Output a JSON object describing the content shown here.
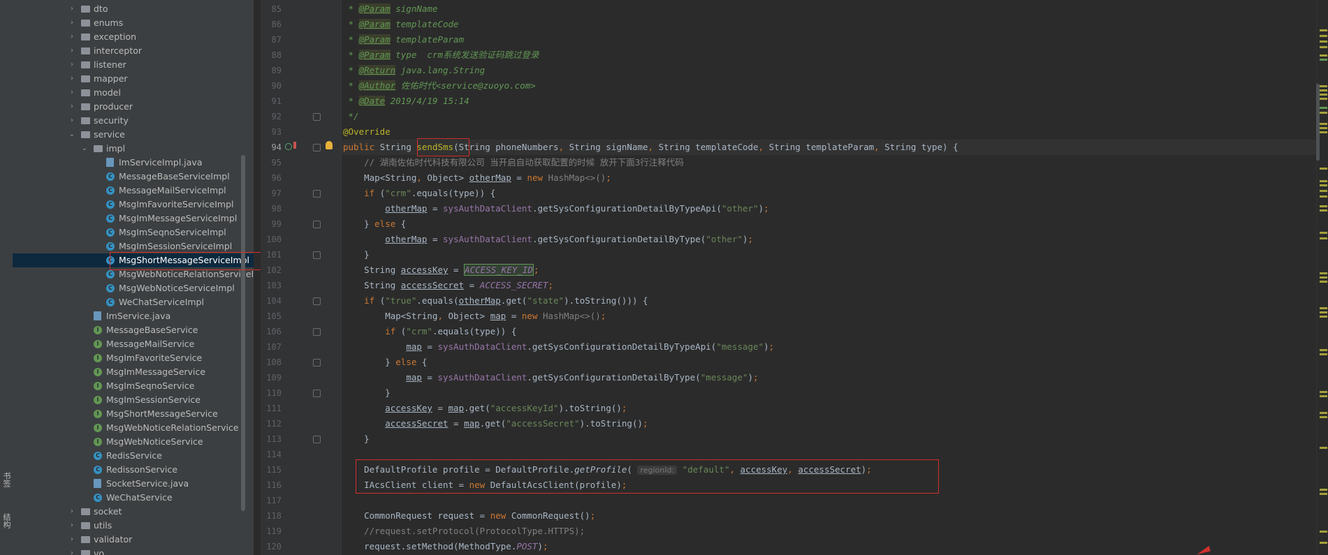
{
  "side_tabs": {
    "bookmarks": "书签",
    "structure": "结构"
  },
  "tree": [
    {
      "label": "dto",
      "type": "folder",
      "depth": 1,
      "expanded": false
    },
    {
      "label": "enums",
      "type": "folder",
      "depth": 1,
      "expanded": false
    },
    {
      "label": "exception",
      "type": "folder",
      "depth": 1,
      "expanded": false
    },
    {
      "label": "interceptor",
      "type": "folder",
      "depth": 1,
      "expanded": false
    },
    {
      "label": "listener",
      "type": "folder",
      "depth": 1,
      "expanded": false
    },
    {
      "label": "mapper",
      "type": "folder",
      "depth": 1,
      "expanded": false
    },
    {
      "label": "model",
      "type": "folder",
      "depth": 1,
      "expanded": false
    },
    {
      "label": "producer",
      "type": "folder",
      "depth": 1,
      "expanded": false
    },
    {
      "label": "security",
      "type": "folder",
      "depth": 1,
      "expanded": false
    },
    {
      "label": "service",
      "type": "folder",
      "depth": 1,
      "expanded": true
    },
    {
      "label": "impl",
      "type": "folder",
      "depth": 2,
      "expanded": true
    },
    {
      "label": "ImServiceImpl.java",
      "type": "java",
      "depth": 3
    },
    {
      "label": "MessageBaseServiceImpl",
      "type": "class",
      "depth": 3
    },
    {
      "label": "MessageMailServiceImpl",
      "type": "class",
      "depth": 3
    },
    {
      "label": "MsgImFavoriteServiceImpl",
      "type": "class",
      "depth": 3
    },
    {
      "label": "MsgImMessageServiceImpl",
      "type": "class",
      "depth": 3
    },
    {
      "label": "MsgImSeqnoServiceImpl",
      "type": "class",
      "depth": 3
    },
    {
      "label": "MsgImSessionServiceImpl",
      "type": "class",
      "depth": 3
    },
    {
      "label": "MsgShortMessageServiceImpl",
      "type": "class",
      "depth": 3,
      "selected": true
    },
    {
      "label": "MsgWebNoticeRelationServiceIm",
      "type": "class",
      "depth": 3
    },
    {
      "label": "MsgWebNoticeServiceImpl",
      "type": "class",
      "depth": 3
    },
    {
      "label": "WeChatServiceImpl",
      "type": "class",
      "depth": 3
    },
    {
      "label": "ImService.java",
      "type": "java",
      "depth": 2
    },
    {
      "label": "MessageBaseService",
      "type": "interface",
      "depth": 2
    },
    {
      "label": "MessageMailService",
      "type": "interface",
      "depth": 2
    },
    {
      "label": "MsgImFavoriteService",
      "type": "interface",
      "depth": 2
    },
    {
      "label": "MsgImMessageService",
      "type": "interface",
      "depth": 2
    },
    {
      "label": "MsgImSeqnoService",
      "type": "interface",
      "depth": 2
    },
    {
      "label": "MsgImSessionService",
      "type": "interface",
      "depth": 2
    },
    {
      "label": "MsgShortMessageService",
      "type": "interface",
      "depth": 2
    },
    {
      "label": "MsgWebNoticeRelationService",
      "type": "interface",
      "depth": 2
    },
    {
      "label": "MsgWebNoticeService",
      "type": "interface",
      "depth": 2
    },
    {
      "label": "RedisService",
      "type": "class",
      "depth": 2
    },
    {
      "label": "RedissonService",
      "type": "class",
      "depth": 2
    },
    {
      "label": "SocketService.java",
      "type": "java",
      "depth": 2
    },
    {
      "label": "WeChatService",
      "type": "class",
      "depth": 2
    },
    {
      "label": "socket",
      "type": "folder",
      "depth": 1,
      "expanded": false
    },
    {
      "label": "utils",
      "type": "folder",
      "depth": 1,
      "expanded": false
    },
    {
      "label": "validator",
      "type": "folder",
      "depth": 1,
      "expanded": false
    },
    {
      "label": "vo",
      "type": "folder",
      "depth": 1,
      "expanded": false
    }
  ],
  "editor": {
    "current_line": 94,
    "lines": [
      {
        "n": 85,
        "t": [
          [
            " * ",
            "dcm"
          ],
          [
            "@Param",
            "tag"
          ],
          [
            " signName",
            "dcm"
          ]
        ]
      },
      {
        "n": 86,
        "t": [
          [
            " * ",
            "dcm"
          ],
          [
            "@Param",
            "tag"
          ],
          [
            " templateCode",
            "dcm"
          ]
        ]
      },
      {
        "n": 87,
        "t": [
          [
            " * ",
            "dcm"
          ],
          [
            "@Param",
            "tag"
          ],
          [
            " templateParam",
            "dcm"
          ]
        ]
      },
      {
        "n": 88,
        "t": [
          [
            " * ",
            "dcm"
          ],
          [
            "@Param",
            "tag"
          ],
          [
            " type  crm系统发送验证码跳过登录",
            "dcm"
          ]
        ]
      },
      {
        "n": 89,
        "t": [
          [
            " * ",
            "dcm"
          ],
          [
            "@Return",
            "tag"
          ],
          [
            " java.lang.String",
            "dcm"
          ]
        ]
      },
      {
        "n": 90,
        "t": [
          [
            " * ",
            "dcm"
          ],
          [
            "@Author",
            "tag"
          ],
          [
            " 佐佑时代<service@zuoyo.com>",
            "dcm"
          ]
        ]
      },
      {
        "n": 91,
        "t": [
          [
            " * ",
            "dcm"
          ],
          [
            "@Date",
            "tag"
          ],
          [
            " 2019/4/19 15:14",
            "dcm"
          ]
        ]
      },
      {
        "n": 92,
        "t": [
          [
            " */",
            "dcm"
          ]
        ]
      },
      {
        "n": 93,
        "t": [
          [
            "@Override",
            "ann"
          ]
        ]
      },
      {
        "n": 94,
        "t": [
          [
            "public ",
            "kw"
          ],
          [
            "String ",
            ""
          ],
          [
            "sendSms",
            "ann"
          ],
          [
            "(String phoneNumbers",
            ""
          ],
          [
            ", ",
            "kw"
          ],
          [
            "String signName",
            ""
          ],
          [
            ", ",
            "kw"
          ],
          [
            "String templateCode",
            ""
          ],
          [
            ", ",
            "kw"
          ],
          [
            "String templateParam",
            ""
          ],
          [
            ", ",
            "kw"
          ],
          [
            "String type) {",
            ""
          ]
        ]
      },
      {
        "n": 95,
        "t": [
          [
            "    // 湖南佐佑时代科技有限公司 当开启自动获取配置的时候 放开下面3行注释代码",
            "cm"
          ]
        ]
      },
      {
        "n": 96,
        "t": [
          [
            "    Map<String",
            ""
          ],
          [
            ", ",
            "kw"
          ],
          [
            "Object> ",
            ""
          ],
          [
            "otherMap",
            "u"
          ],
          [
            " = ",
            ""
          ],
          [
            "new ",
            "kw"
          ],
          [
            "HashMap<>()",
            "cm"
          ],
          [
            ";",
            "kw"
          ]
        ]
      },
      {
        "n": 97,
        "t": [
          [
            "    ",
            ""
          ],
          [
            "if ",
            "kw"
          ],
          [
            "(",
            ""
          ],
          [
            "\"crm\"",
            "str"
          ],
          [
            ".equals(type)) {",
            ""
          ]
        ]
      },
      {
        "n": 98,
        "t": [
          [
            "        ",
            ""
          ],
          [
            "otherMap",
            "u"
          ],
          [
            " = ",
            ""
          ],
          [
            "sysAuthDataClient",
            "fld"
          ],
          [
            ".getSysConfigurationDetailByTypeApi(",
            ""
          ],
          [
            "\"other\"",
            "str"
          ],
          [
            ")",
            ""
          ],
          [
            ";",
            "kw"
          ]
        ]
      },
      {
        "n": 99,
        "t": [
          [
            "    } ",
            ""
          ],
          [
            "else ",
            "kw"
          ],
          [
            "{",
            ""
          ]
        ]
      },
      {
        "n": 100,
        "t": [
          [
            "        ",
            ""
          ],
          [
            "otherMap",
            "u"
          ],
          [
            " = ",
            ""
          ],
          [
            "sysAuthDataClient",
            "fld"
          ],
          [
            ".getSysConfigurationDetailByType(",
            ""
          ],
          [
            "\"other\"",
            "str"
          ],
          [
            ")",
            ""
          ],
          [
            ";",
            "kw"
          ]
        ]
      },
      {
        "n": 101,
        "t": [
          [
            "    }",
            ""
          ]
        ]
      },
      {
        "n": 102,
        "t": [
          [
            "    String ",
            ""
          ],
          [
            "accessKey",
            "u"
          ],
          [
            " = ",
            ""
          ],
          [
            "ACCESS_KEY_ID",
            "hl-id"
          ],
          [
            ";",
            "kw"
          ]
        ]
      },
      {
        "n": 103,
        "t": [
          [
            "    String ",
            ""
          ],
          [
            "accessSecret",
            "u"
          ],
          [
            " = ",
            ""
          ],
          [
            "ACCESS_SECRET",
            "cst"
          ],
          [
            ";",
            "kw"
          ]
        ]
      },
      {
        "n": 104,
        "t": [
          [
            "    ",
            ""
          ],
          [
            "if ",
            "kw"
          ],
          [
            "(",
            ""
          ],
          [
            "\"true\"",
            "str"
          ],
          [
            ".equals(",
            ""
          ],
          [
            "otherMap",
            "u"
          ],
          [
            ".get(",
            ""
          ],
          [
            "\"state\"",
            "str"
          ],
          [
            ").toString())) {",
            ""
          ]
        ]
      },
      {
        "n": 105,
        "t": [
          [
            "        Map<String",
            ""
          ],
          [
            ", ",
            "kw"
          ],
          [
            "Object> ",
            ""
          ],
          [
            "map",
            "u"
          ],
          [
            " = ",
            ""
          ],
          [
            "new ",
            "kw"
          ],
          [
            "HashMap<>()",
            "cm"
          ],
          [
            ";",
            "kw"
          ]
        ]
      },
      {
        "n": 106,
        "t": [
          [
            "        ",
            ""
          ],
          [
            "if ",
            "kw"
          ],
          [
            "(",
            ""
          ],
          [
            "\"crm\"",
            "str"
          ],
          [
            ".equals(type)) {",
            ""
          ]
        ]
      },
      {
        "n": 107,
        "t": [
          [
            "            ",
            ""
          ],
          [
            "map",
            "u"
          ],
          [
            " = ",
            ""
          ],
          [
            "sysAuthDataClient",
            "fld"
          ],
          [
            ".getSysConfigurationDetailByTypeApi(",
            ""
          ],
          [
            "\"message\"",
            "str"
          ],
          [
            ")",
            ""
          ],
          [
            ";",
            "kw"
          ]
        ]
      },
      {
        "n": 108,
        "t": [
          [
            "        } ",
            ""
          ],
          [
            "else ",
            "kw"
          ],
          [
            "{",
            ""
          ]
        ]
      },
      {
        "n": 109,
        "t": [
          [
            "            ",
            ""
          ],
          [
            "map",
            "u"
          ],
          [
            " = ",
            ""
          ],
          [
            "sysAuthDataClient",
            "fld"
          ],
          [
            ".getSysConfigurationDetailByType(",
            ""
          ],
          [
            "\"message\"",
            "str"
          ],
          [
            ")",
            ""
          ],
          [
            ";",
            "kw"
          ]
        ]
      },
      {
        "n": 110,
        "t": [
          [
            "        }",
            ""
          ]
        ]
      },
      {
        "n": 111,
        "t": [
          [
            "        ",
            ""
          ],
          [
            "accessKey",
            "u"
          ],
          [
            " = ",
            ""
          ],
          [
            "map",
            "u"
          ],
          [
            ".get(",
            ""
          ],
          [
            "\"accessKeyId\"",
            "str"
          ],
          [
            ").toString()",
            ""
          ],
          [
            ";",
            "kw"
          ]
        ]
      },
      {
        "n": 112,
        "t": [
          [
            "        ",
            ""
          ],
          [
            "accessSecret",
            "u"
          ],
          [
            " = ",
            ""
          ],
          [
            "map",
            "u"
          ],
          [
            ".get(",
            ""
          ],
          [
            "\"accessSecret\"",
            "str"
          ],
          [
            ").toString()",
            ""
          ],
          [
            ";",
            "kw"
          ]
        ]
      },
      {
        "n": 113,
        "t": [
          [
            "    }",
            ""
          ]
        ]
      },
      {
        "n": 114,
        "t": []
      },
      {
        "n": 115,
        "t": [
          [
            "    DefaultProfile profile = DefaultProfile.",
            ""
          ],
          [
            "getProfile",
            "fn-i"
          ],
          [
            "( ",
            ""
          ],
          [
            "regionId:",
            "hint"
          ],
          [
            " ",
            ""
          ],
          [
            "\"default\"",
            "str"
          ],
          [
            ", ",
            "kw"
          ],
          [
            "accessKey",
            "u"
          ],
          [
            ", ",
            "kw"
          ],
          [
            "accessSecret",
            "u"
          ],
          [
            ")",
            ""
          ],
          [
            ";",
            "kw"
          ]
        ]
      },
      {
        "n": 116,
        "t": [
          [
            "    IAcsClient client = ",
            ""
          ],
          [
            "new ",
            "kw"
          ],
          [
            "DefaultAcsClient(profile)",
            ""
          ],
          [
            ";",
            "kw"
          ]
        ]
      },
      {
        "n": 117,
        "t": []
      },
      {
        "n": 118,
        "t": [
          [
            "    CommonRequest request = ",
            ""
          ],
          [
            "new ",
            "kw"
          ],
          [
            "CommonRequest()",
            ""
          ],
          [
            ";",
            "kw"
          ]
        ]
      },
      {
        "n": 119,
        "t": [
          [
            "    //request.setProtocol(ProtocolType.HTTPS);",
            "cm"
          ]
        ]
      },
      {
        "n": 120,
        "t": [
          [
            "    request.setMethod(MethodType.",
            ""
          ],
          [
            "POST",
            "cst"
          ],
          [
            ")",
            ""
          ],
          [
            ";",
            "kw"
          ]
        ]
      }
    ]
  },
  "colors": {
    "highlight_box": "#d0312d",
    "tree_selection": "#0d293e",
    "editor_bg": "#2b2b2b"
  }
}
